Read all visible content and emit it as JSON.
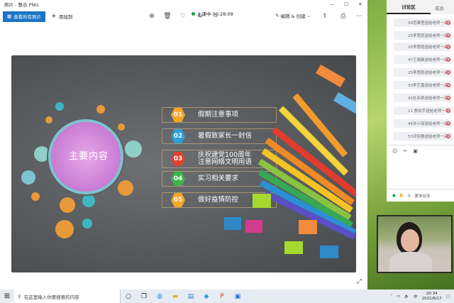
{
  "window": {
    "title": "照片 - 整合.PNG",
    "recording": "上课中 00:28:09"
  },
  "toolbar": {
    "view_all": "查看所有照片",
    "add_to": "添加到",
    "edit_create": "编辑 & 创建"
  },
  "slide": {
    "title": "主要内容",
    "items": [
      {
        "num": "01",
        "label": "假期注意事项",
        "color": "#f5a623"
      },
      {
        "num": "02",
        "label": "暑假致家长一封信",
        "color": "#2b9fd9"
      },
      {
        "num": "03",
        "label": "庆祝建党100周年 注意网络文明用语",
        "color": "#e0422c"
      },
      {
        "num": "04",
        "label": "实习相关要求",
        "color": "#3bb54a"
      },
      {
        "num": "05",
        "label": "做好疫情防控",
        "color": "#f5a623"
      }
    ]
  },
  "chat": {
    "tab_discussion": "讨论区",
    "tab_members": "成员",
    "messages": [
      "09范雅萱送给老师一朵",
      "25李思雨送给老师一朵",
      "25李思雨送给老师一朵",
      "47王晓敏送给老师一朵",
      "25李思雨送给老师一朵",
      "33李艺嘉送给老师一朵",
      "41杜亚续送给老师一朵",
      "11 詹钦宇送给老师一朵",
      "45孙小琛送给老师一朵",
      "53邓佳雯送给老师一朵"
    ],
    "bottom_text": "更多玩法"
  },
  "taskbar": {
    "search_placeholder": "在这里输入你要搜索的内容",
    "time": "20:34",
    "date": "2021/6/17",
    "ime": "中"
  },
  "colors": {
    "accent": "#1a73c8",
    "recording": "#16a34a",
    "slide_bg": "#55585b",
    "circle_pink": "#c87bd3"
  }
}
